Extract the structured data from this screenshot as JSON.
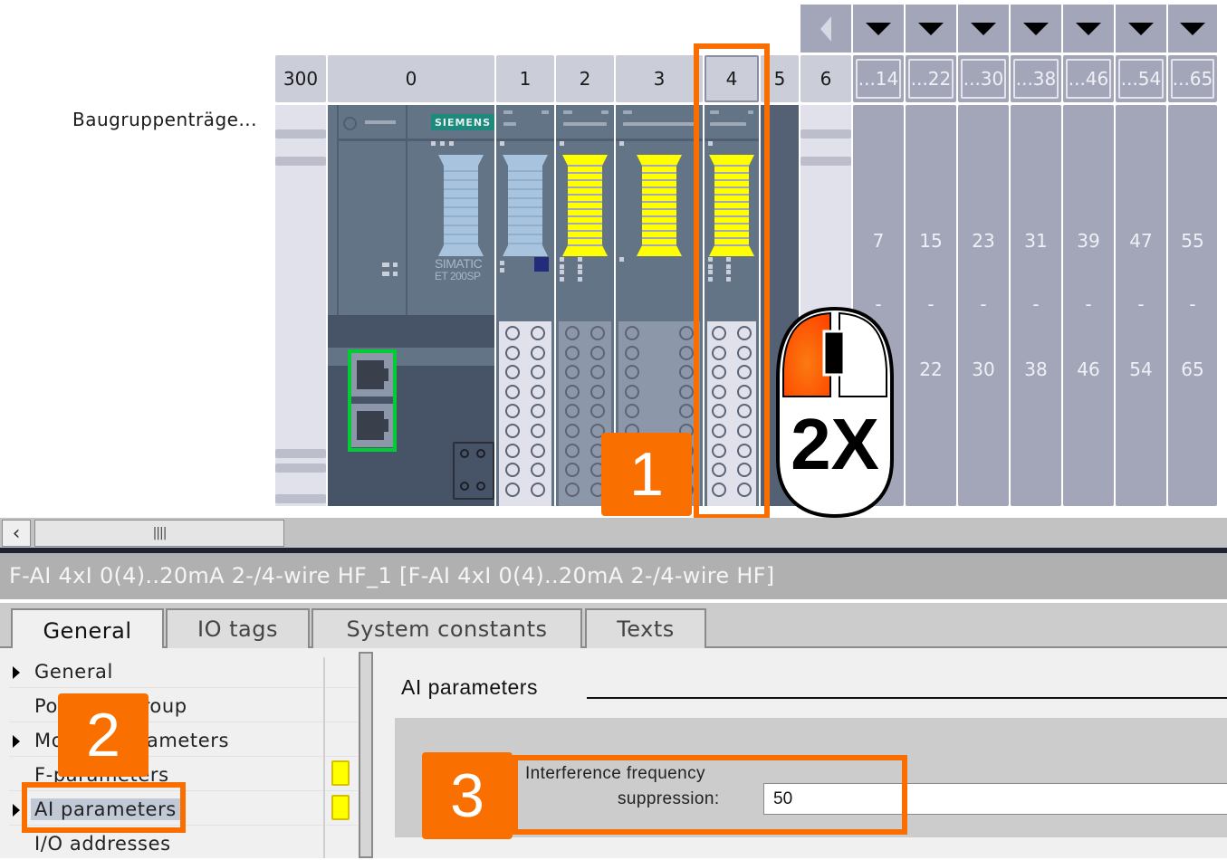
{
  "device_view": {
    "rack_label": "Baugruppenträge...",
    "slots": [
      {
        "id": "300",
        "label": "300"
      },
      {
        "id": "0",
        "label": "0"
      },
      {
        "id": "1",
        "label": "1"
      },
      {
        "id": "2",
        "label": "2"
      },
      {
        "id": "3",
        "label": "3"
      },
      {
        "id": "4",
        "label": "4"
      },
      {
        "id": "5",
        "label": "5"
      },
      {
        "id": "6",
        "label": "6"
      }
    ],
    "slot_ranges": [
      "...14",
      "...22",
      "...30",
      "...38",
      "...46",
      "...54",
      "...65"
    ],
    "empty_columns": [
      {
        "start": "7",
        "end": ""
      },
      {
        "start": "15",
        "end": "22"
      },
      {
        "start": "23",
        "end": "30"
      },
      {
        "start": "31",
        "end": "38"
      },
      {
        "start": "39",
        "end": "46"
      },
      {
        "start": "47",
        "end": "54"
      },
      {
        "start": "55",
        "end": "65"
      }
    ],
    "range_separator": "-",
    "interface_module": {
      "brand": "SIEMENS",
      "product_line1": "SIMATIC",
      "product_line2": "ET 200SP"
    },
    "colors": {
      "highlight_orange": "#fa6e00",
      "port_highlight_green": "#00cc33",
      "fail_safe_yellow": "#ffff00",
      "standard_blue": "#a7c3dd"
    }
  },
  "annotations": {
    "step1": "1",
    "step2": "2",
    "step3": "3",
    "double_click": "2X"
  },
  "scrollbar": {
    "left_arrow": "‹",
    "grip": "||||"
  },
  "inspector": {
    "title": "F-AI 4xI 0(4)..20mA 2-/4-wire HF_1 [F-AI 4xI 0(4)..20mA 2-/4-wire HF]",
    "tabs": [
      {
        "label": "General",
        "active": true
      },
      {
        "label": "IO tags",
        "active": false
      },
      {
        "label": "System constants",
        "active": false
      },
      {
        "label": "Texts",
        "active": false
      }
    ],
    "tree": [
      {
        "label": "General",
        "expandable": true,
        "warning": false,
        "selected": false
      },
      {
        "label": "Potential group",
        "expandable": false,
        "warning": false,
        "selected": false
      },
      {
        "label": "Module parameters",
        "expandable": true,
        "warning": false,
        "selected": false
      },
      {
        "label": "F-parameters",
        "expandable": false,
        "warning": true,
        "selected": false
      },
      {
        "label": "AI parameters",
        "expandable": true,
        "warning": true,
        "selected": true
      },
      {
        "label": "I/O addresses",
        "expandable": false,
        "warning": false,
        "selected": false
      }
    ],
    "section_title": "AI parameters",
    "parameter": {
      "label_line1": "Interference frequency",
      "label_line2": "suppression:",
      "value": "50"
    }
  }
}
